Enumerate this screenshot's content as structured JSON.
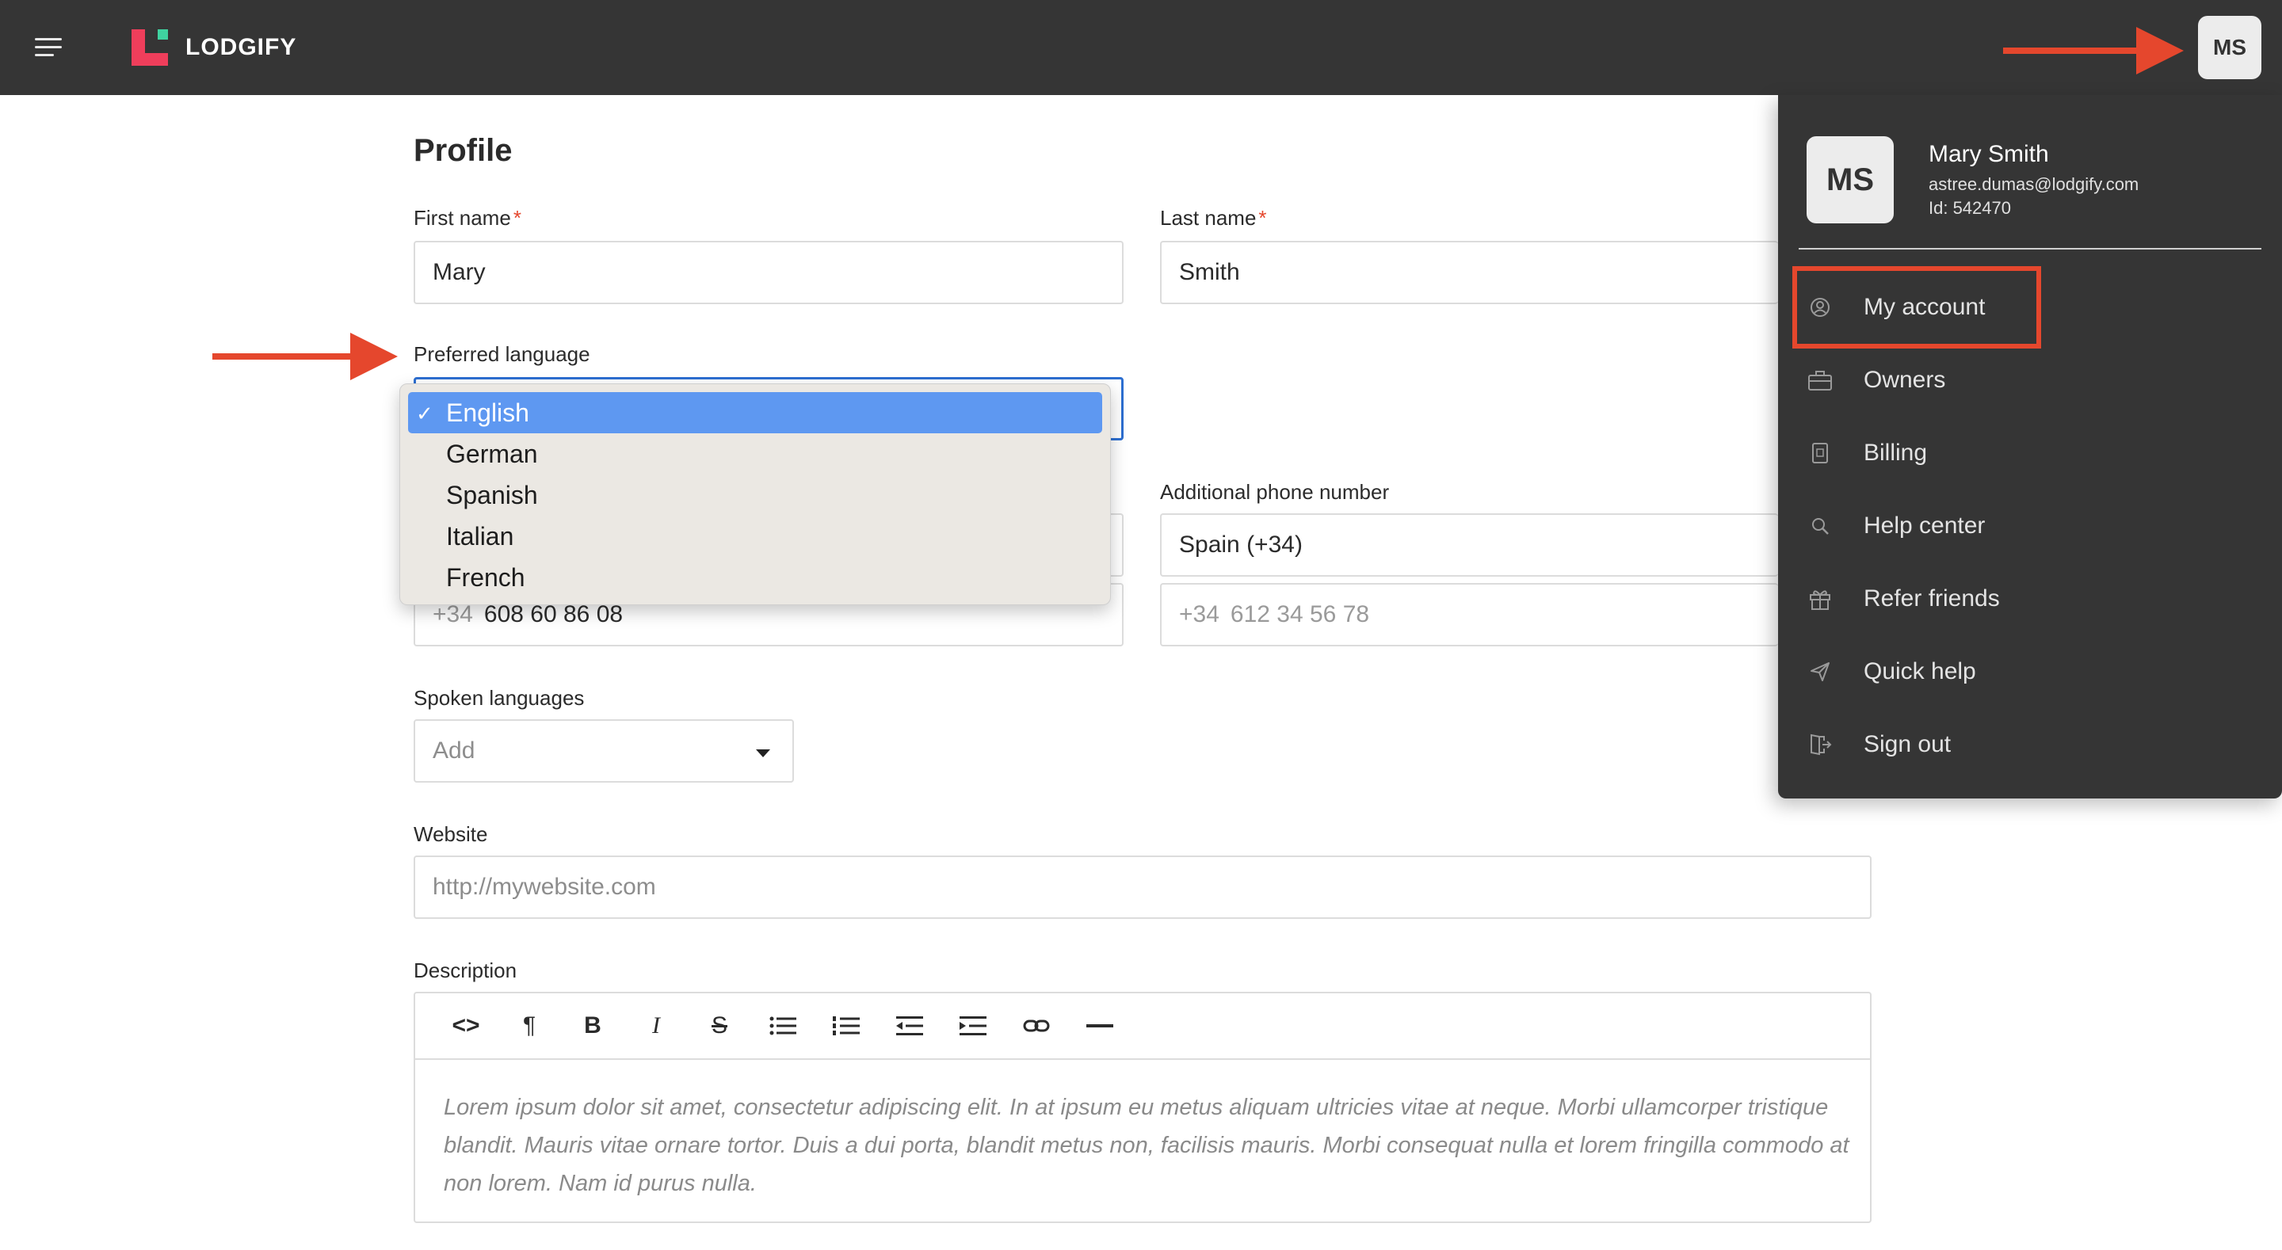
{
  "header": {
    "brand": "LODGIFY",
    "avatar_initials": "MS"
  },
  "profile": {
    "title": "Profile",
    "first_name_label": "First name",
    "first_name_value": "Mary",
    "last_name_label": "Last name",
    "last_name_value": "Smith",
    "required_mark": "*",
    "preferred_language_label": "Preferred language",
    "language_options": [
      "English",
      "German",
      "Spanish",
      "Italian",
      "French"
    ],
    "selected_language": "English",
    "check_mark": "✓",
    "additional_phone_label": "Additional phone number",
    "additional_phone_country": "Spain (+34)",
    "phone_prefix": "+34",
    "phone_value": "608 60 86 08",
    "additional_phone_prefix": "+34",
    "additional_phone_placeholder": "612 34 56 78",
    "spoken_languages_label": "Spoken languages",
    "spoken_languages_placeholder": "Add",
    "website_label": "Website",
    "website_placeholder": "http://mywebsite.com",
    "description_label": "Description",
    "description_placeholder": "Lorem ipsum dolor sit amet, consectetur adipiscing elit. In at ipsum eu metus aliquam ultricies vitae at neque. Morbi ullamcorper tristique blandit. Mauris vitae ornare tortor. Duis a dui porta, blandit metus non, facilisis mauris. Morbi consequat nulla et lorem fringilla commodo at non lorem. Nam id purus nulla."
  },
  "editor_toolbar": {
    "code": "<>",
    "paragraph": "¶",
    "bold": "B",
    "italic": "I",
    "strike": "S"
  },
  "account_menu": {
    "initials": "MS",
    "name": "Mary Smith",
    "email": "astree.dumas@lodgify.com",
    "id": "Id: 542470",
    "items": [
      {
        "label": "My account",
        "icon": "user-circle-icon"
      },
      {
        "label": "Owners",
        "icon": "briefcase-icon"
      },
      {
        "label": "Billing",
        "icon": "invoice-icon"
      },
      {
        "label": "Help center",
        "icon": "search-icon"
      },
      {
        "label": "Refer friends",
        "icon": "gift-icon"
      },
      {
        "label": "Quick help",
        "icon": "paper-plane-icon"
      },
      {
        "label": "Sign out",
        "icon": "sign-out-icon"
      }
    ]
  },
  "colors": {
    "topbar": "#353535",
    "brand_red": "#ef3e5b",
    "brand_green": "#3fd3a0",
    "annotation": "#e5472d",
    "selection": "#5e98f1",
    "focus": "#2d6fd1"
  }
}
